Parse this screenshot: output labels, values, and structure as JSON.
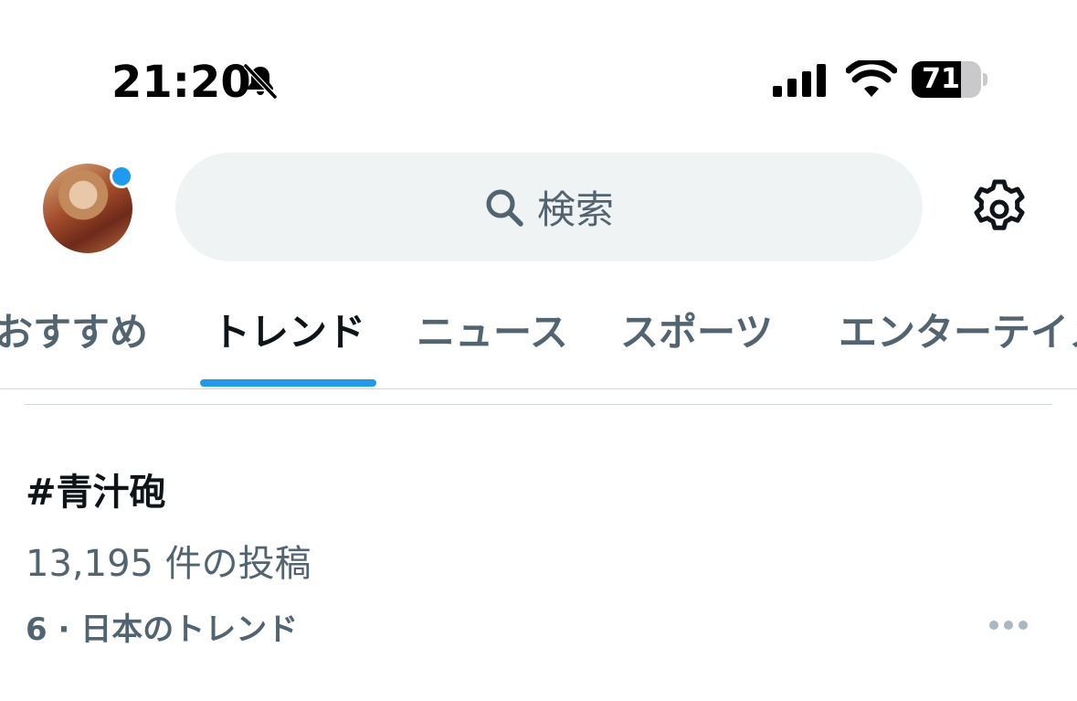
{
  "status_bar": {
    "time": "21:20",
    "battery_level": "71",
    "battery_fraction": 0.71,
    "icons": [
      "bell-slash-icon",
      "cellular-signal-icon",
      "wifi-icon",
      "battery-icon"
    ]
  },
  "header": {
    "search_placeholder": "検索",
    "icons": [
      "avatar",
      "search-icon",
      "gear-icon"
    ]
  },
  "tabs": [
    {
      "label": "おすすめ",
      "active": false
    },
    {
      "label": "トレンド",
      "active": true
    },
    {
      "label": "ニュース",
      "active": false
    },
    {
      "label": "スポーツ",
      "active": false
    },
    {
      "label": "エンターテイメ",
      "active": false
    }
  ],
  "trend": {
    "title": "#青汁砲",
    "post_count": "13,195 件の投稿",
    "meta": "6 · 日本のトレンド"
  },
  "colors": {
    "accent": "#1d9bf0",
    "text_primary": "#0f1419",
    "text_secondary": "#536471",
    "search_bg": "#eff3f4"
  }
}
